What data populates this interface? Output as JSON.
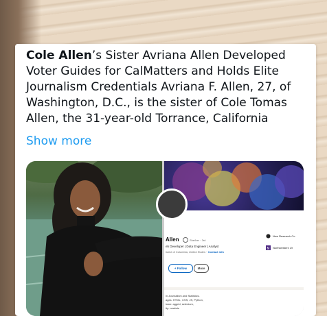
{
  "post": {
    "author_name": "Cole Allen",
    "text_after_name": "’s Sister Avriana Allen Developed Voter Guides for CalMatters and Holds Elite Journalism Credentials  Avriana F. Allen, 27, of Washington, D.C., is the sister of Cole Tomas Allen, the 31-year-old Torrance, California",
    "show_more": "Show more"
  },
  "linkedin": {
    "name": "Allen",
    "pronoun": "She/her · 3rd",
    "headline": "eb Developer | Data Engineer | Analyst",
    "location": "istrict of Columbia, United States ·",
    "contact_info": "Contact info",
    "follow_label": "+ Follow",
    "more_label": "More",
    "orgs": [
      {
        "name": "New Research Co"
      },
      {
        "name": "Northwestern Ur"
      }
    ],
    "about_lines": [
      "in Journalism and Statistics.",
      "ages: HTML, CSS, JS, Python,",
      "ision: aggrid, selenium,",
      "ity: newlets"
    ]
  },
  "colors": {
    "link": "#1d9bf0",
    "linkedin_blue": "#0a66c2",
    "text": "#0f1419"
  }
}
